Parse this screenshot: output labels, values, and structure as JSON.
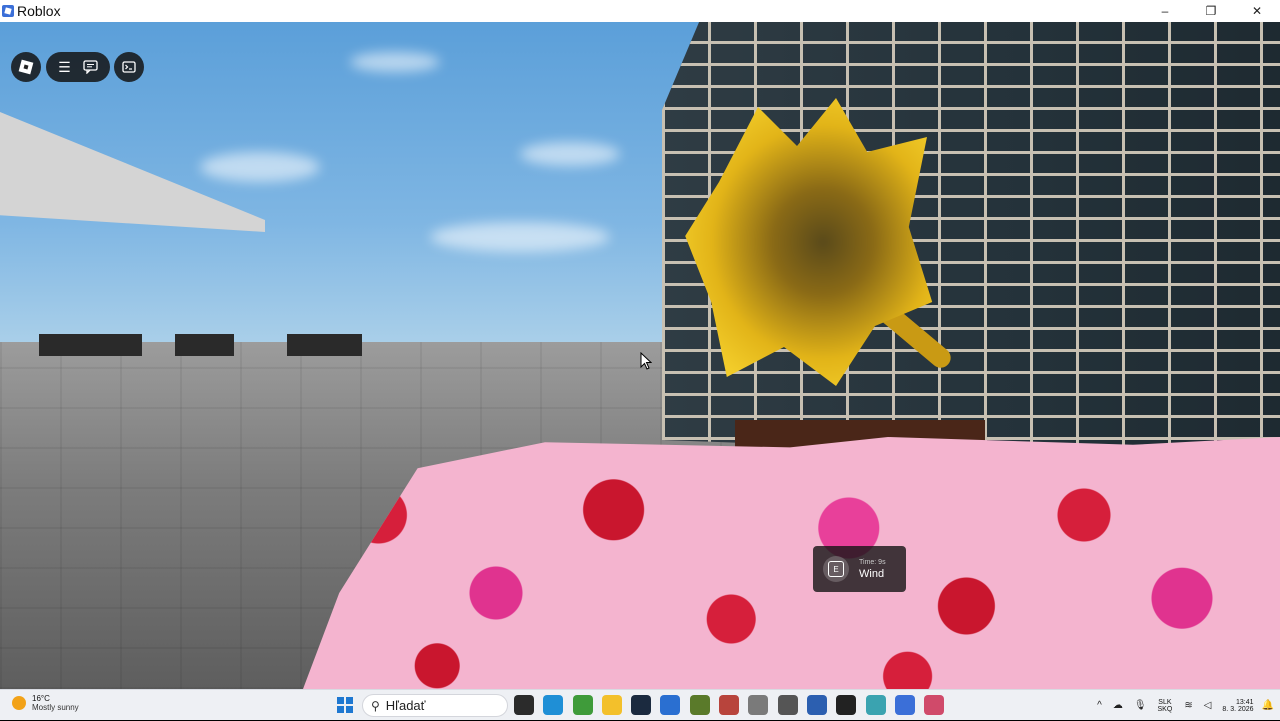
{
  "window": {
    "title": "Roblox",
    "minimize": "–",
    "maximize": "❐",
    "close": "✕"
  },
  "roblox_ui": {
    "menu_icon": "hamburger-menu-icon",
    "chat_icon": "chat-icon",
    "console_icon": "console-icon"
  },
  "prompt": {
    "key": "E",
    "timer": "Time: 9s",
    "action": "Wind"
  },
  "taskbar": {
    "weather_temp": "16°C",
    "weather_condition": "Mostly sunny",
    "search_placeholder": "Hľadať",
    "apps": [
      {
        "name": "task-view",
        "color": "#2b2b2b"
      },
      {
        "name": "edge",
        "color": "#1f8fd6"
      },
      {
        "name": "minecraft",
        "color": "#3f9b3a"
      },
      {
        "name": "file-explorer",
        "color": "#f3c02b"
      },
      {
        "name": "steam",
        "color": "#1b2a3f"
      },
      {
        "name": "store",
        "color": "#2a6fd1"
      },
      {
        "name": "minecraft-launcher",
        "color": "#5a7a2a"
      },
      {
        "name": "app-red",
        "color": "#b8443c"
      },
      {
        "name": "app-gray",
        "color": "#7a7a7a"
      },
      {
        "name": "app-spider",
        "color": "#555555"
      },
      {
        "name": "app-blue",
        "color": "#2c5fb0"
      },
      {
        "name": "roblox-studio",
        "color": "#222222"
      },
      {
        "name": "app-globe",
        "color": "#3aa3b0"
      },
      {
        "name": "roblox",
        "color": "#3b6fd8"
      },
      {
        "name": "snipping-tool",
        "color": "#d04a6a"
      }
    ],
    "language_top": "SLK",
    "language_bottom": "SKQ",
    "time": "13:41",
    "date": "8. 3. 2026"
  }
}
